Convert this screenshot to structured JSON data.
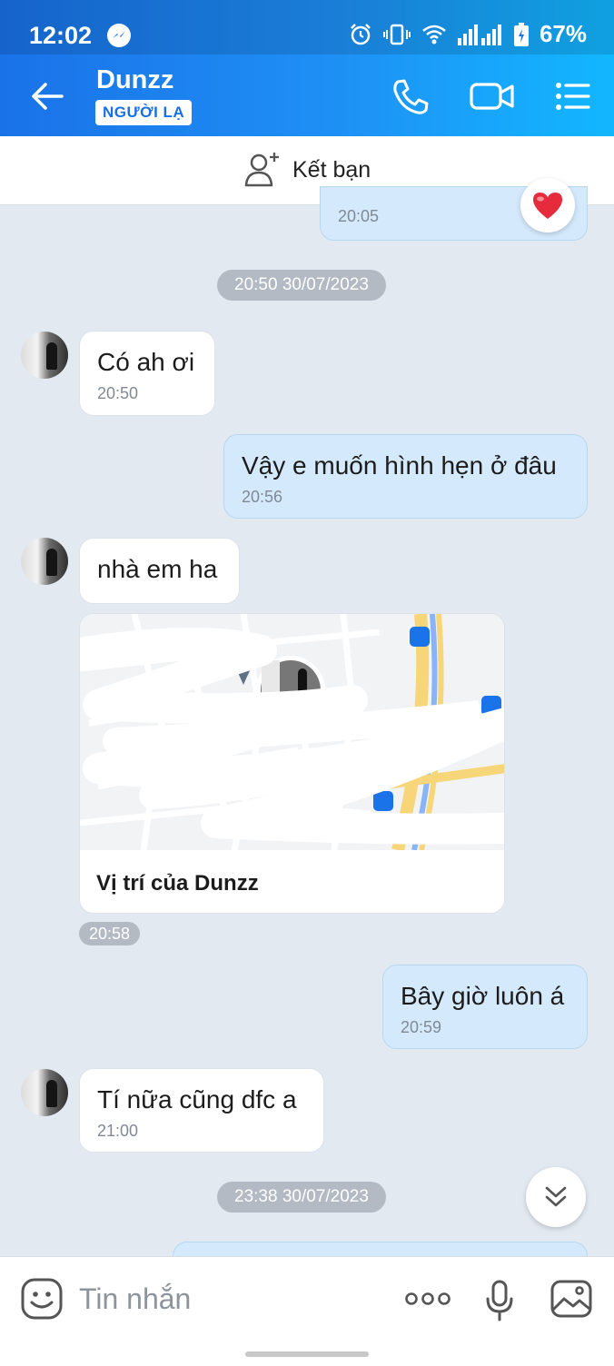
{
  "status_bar": {
    "time": "12:02",
    "battery": "67%"
  },
  "header": {
    "name": "Dunzz",
    "badge": "NGƯỜI LẠ"
  },
  "friend_bar": {
    "label": "Kết bạn"
  },
  "messages": {
    "partial_time": "20:05",
    "sep1": "20:50 30/07/2023",
    "m1": {
      "text": "Có ah ơi",
      "time": "20:50"
    },
    "m2": {
      "text": "Vậy e muốn hình hẹn ở đâu",
      "time": "20:56"
    },
    "m3": {
      "text": "nhà em ha"
    },
    "location": {
      "label": "Vị trí của Dunzz",
      "time": "20:58"
    },
    "m4": {
      "text": "Bây giờ luôn á",
      "time": "20:59"
    },
    "m5": {
      "text": "Tí nữa cũng dfc a",
      "time": "21:00"
    },
    "sep2": "23:38 30/07/2023"
  },
  "input": {
    "placeholder": "Tin nhắn"
  },
  "colors": {
    "header_start": "#1a72e8",
    "header_end": "#12b7ff",
    "outgoing": "#d4eafc",
    "background": "#e2e9f1"
  }
}
